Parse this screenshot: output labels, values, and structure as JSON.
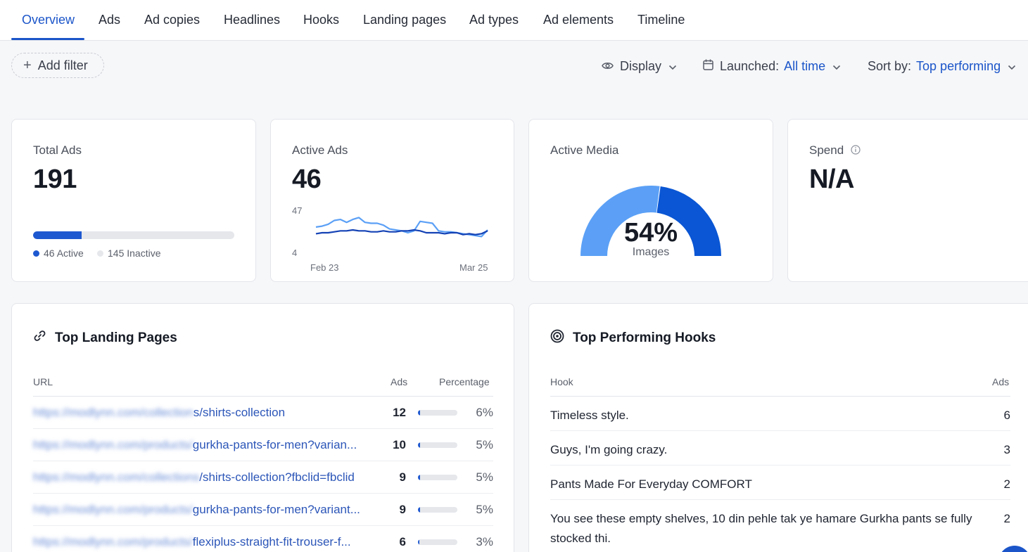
{
  "tabs": [
    "Overview",
    "Ads",
    "Ad copies",
    "Headlines",
    "Hooks",
    "Landing pages",
    "Ad types",
    "Ad elements",
    "Timeline"
  ],
  "toolbar": {
    "add_filter": "Add filter",
    "display": "Display",
    "launched_label": "Launched:",
    "launched_value": "All time",
    "sort_label": "Sort by:",
    "sort_value": "Top performing"
  },
  "stats": {
    "total_ads": {
      "label": "Total Ads",
      "value": "191",
      "active_fraction": 0.24,
      "active_legend": "46 Active",
      "inactive_legend": "145 Inactive",
      "active_color": "#1e58d0",
      "inactive_color": "#e5e7eb"
    },
    "active_ads": {
      "label": "Active Ads",
      "value": "46",
      "y_max_label": "47",
      "y_min_label": "4",
      "x_start_label": "Feb 23",
      "x_end_label": "Mar 25"
    },
    "active_media": {
      "label": "Active Media",
      "percent": "54%",
      "sub": "Images",
      "image_fraction": 0.54,
      "colors": {
        "images": "#5ba0f6",
        "other": "#0a56d4"
      }
    },
    "spend": {
      "label": "Spend",
      "value": "N/A"
    }
  },
  "chart_data": {
    "type": "line",
    "x_labels": [
      "Feb 23",
      "Mar 25"
    ],
    "ylim": [
      4,
      47
    ],
    "series": [
      {
        "values": [
          30,
          31,
          33,
          37,
          38,
          35,
          38,
          40,
          35,
          34,
          34,
          32,
          28,
          27,
          26,
          24,
          26,
          36,
          35,
          34,
          26,
          25,
          25,
          24,
          23,
          22,
          21,
          20,
          27
        ]
      },
      {
        "values": [
          23,
          24,
          24,
          25,
          26,
          26,
          27,
          26,
          26,
          25,
          25,
          26,
          25,
          25,
          26,
          26,
          27,
          26,
          24,
          24,
          24,
          23,
          24,
          24,
          22,
          23,
          22,
          23,
          26
        ]
      }
    ],
    "series_colors": [
      "#5ba0f6",
      "#1442b5"
    ]
  },
  "landing": {
    "title": "Top Landing Pages",
    "col_url": "URL",
    "col_ads": "Ads",
    "col_pct": "Percentage",
    "rows": [
      {
        "url_blur": "https://modlynn.com/collection",
        "url_tail": "s/shirts-collection",
        "ads": "12",
        "pct": "6%",
        "fraction": 0.06
      },
      {
        "url_blur": "https://modlynn.com/products/",
        "url_tail": "gurkha-pants-for-men?varian...",
        "ads": "10",
        "pct": "5%",
        "fraction": 0.05
      },
      {
        "url_blur": "https://modlynn.com/collections",
        "url_tail": "/shirts-collection?fbclid=fbclid",
        "ads": "9",
        "pct": "5%",
        "fraction": 0.05
      },
      {
        "url_blur": "https://modlynn.com/products/",
        "url_tail": "gurkha-pants-for-men?variant...",
        "ads": "9",
        "pct": "5%",
        "fraction": 0.05
      },
      {
        "url_blur": "https://modlynn.com/products/",
        "url_tail": "flexiplus-straight-fit-trouser-f...",
        "ads": "6",
        "pct": "3%",
        "fraction": 0.03
      }
    ]
  },
  "hooks": {
    "title": "Top Performing Hooks",
    "col_hook": "Hook",
    "col_ads": "Ads",
    "rows": [
      {
        "text": "Timeless style.",
        "ads": "6"
      },
      {
        "text": "Guys, I'm going crazy.",
        "ads": "3"
      },
      {
        "text": "Pants Made For Everyday COMFORT",
        "ads": "2"
      },
      {
        "text": "You see these empty shelves, 10 din pehle tak ye hamare Gurkha pants se fully stocked thi.",
        "ads": "2"
      }
    ]
  }
}
